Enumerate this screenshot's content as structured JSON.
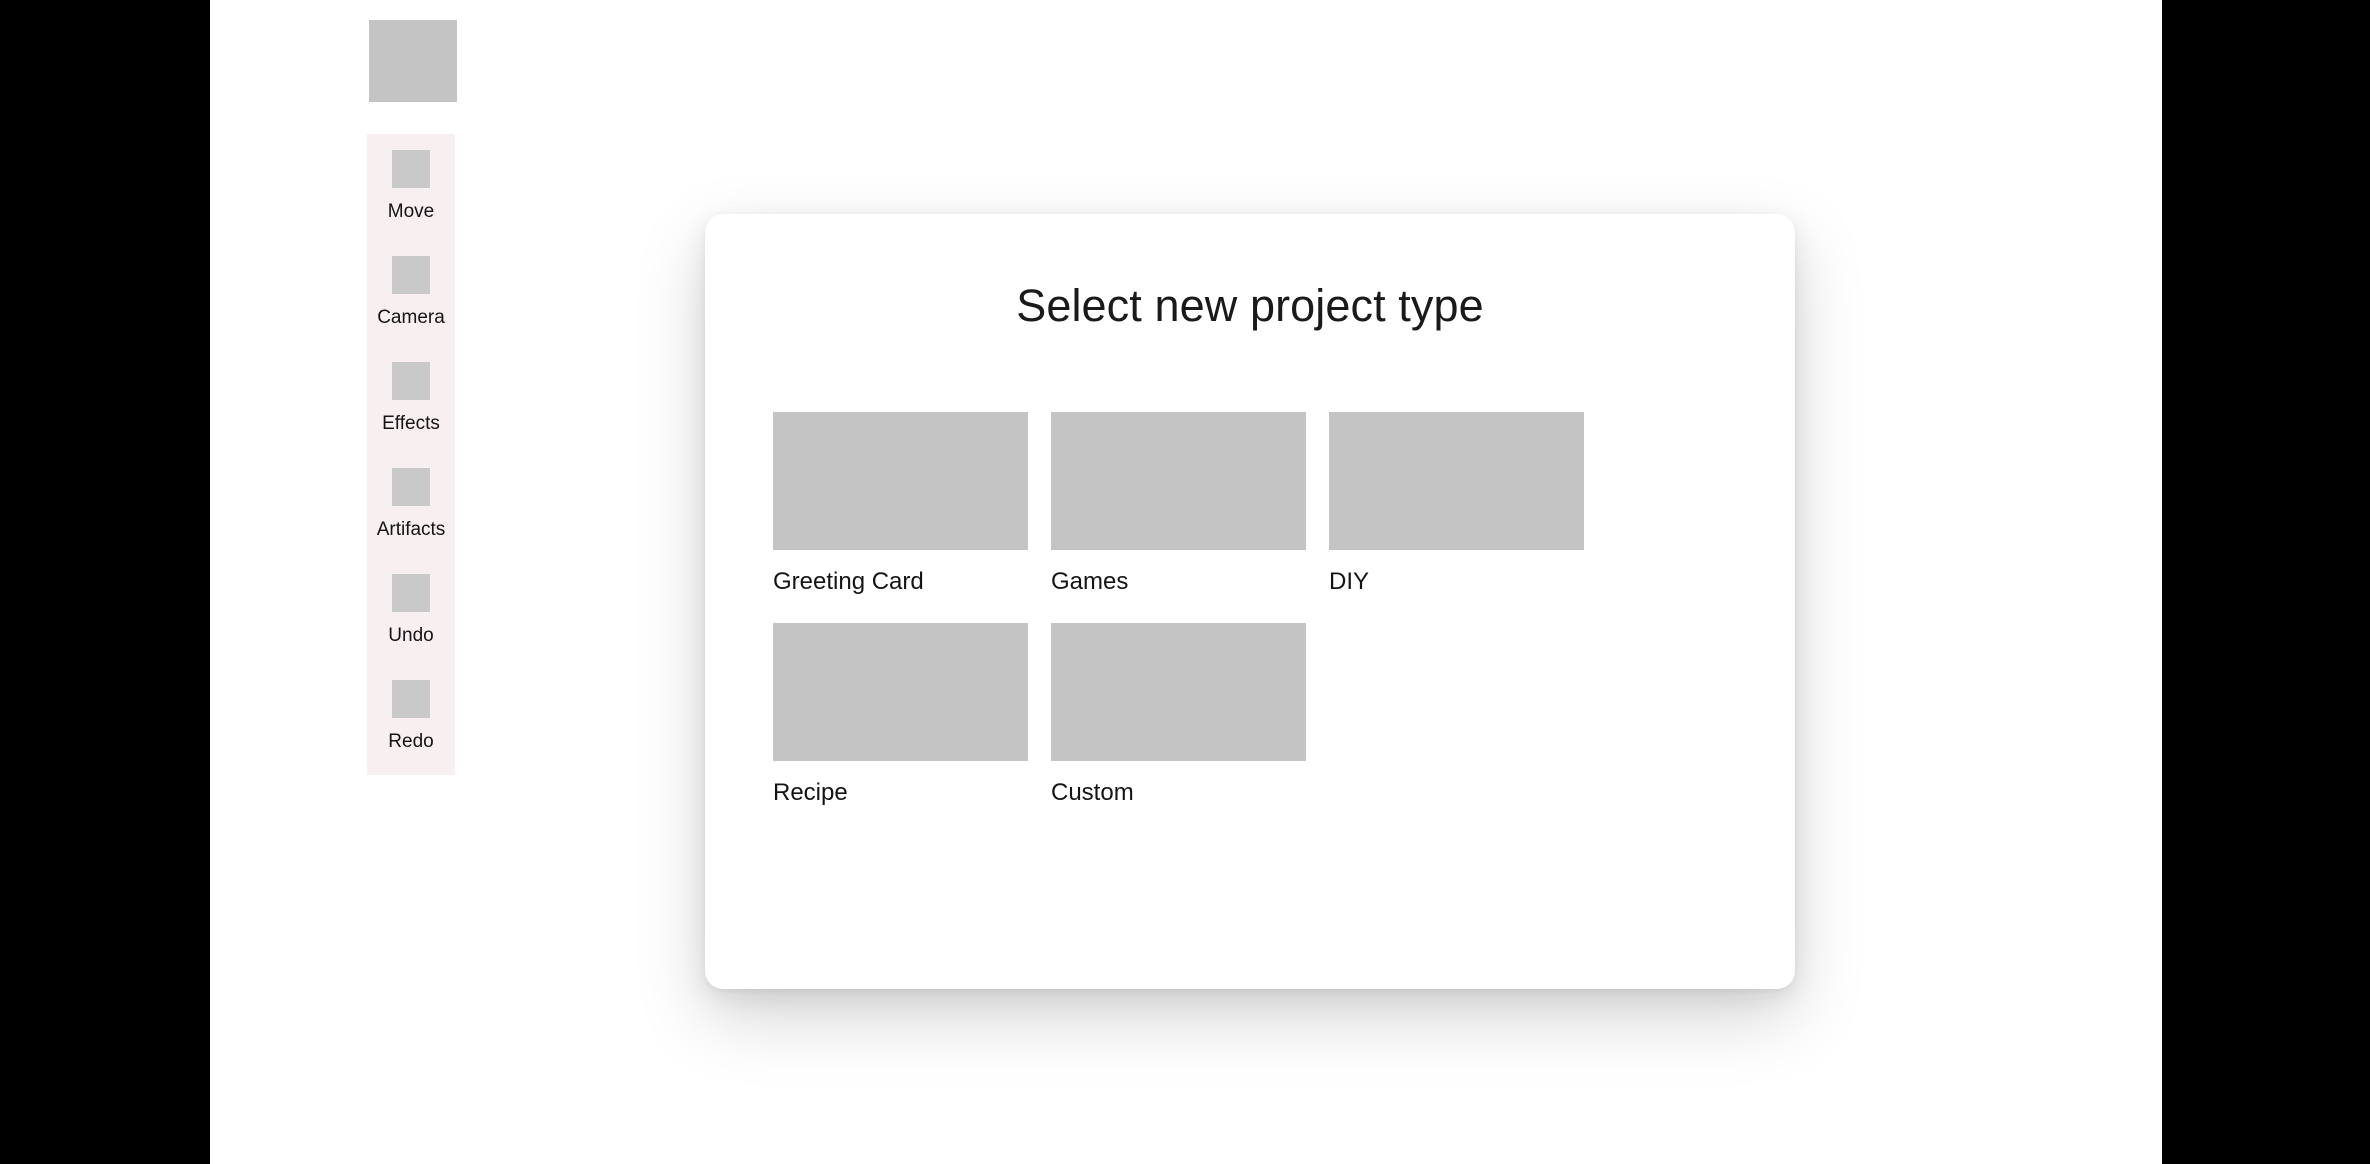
{
  "window": {
    "background_color": "#ffffff",
    "letterbox_color": "#000000"
  },
  "branding": {
    "logo_alt": "logo-placeholder"
  },
  "tool_rail": {
    "background_color": "#f7eff0",
    "items": [
      {
        "label": "Move",
        "icon": "move-icon"
      },
      {
        "label": "Camera",
        "icon": "camera-icon"
      },
      {
        "label": "Effects",
        "icon": "effects-icon"
      },
      {
        "label": "Artifacts",
        "icon": "artifacts-icon"
      },
      {
        "label": "Undo",
        "icon": "undo-icon"
      },
      {
        "label": "Redo",
        "icon": "redo-icon"
      }
    ]
  },
  "modal": {
    "title": "Select new project type",
    "background_color": "#ffffff",
    "project_types": [
      {
        "label": "Greeting Card",
        "thumb": "greeting-card-thumbnail"
      },
      {
        "label": "Games",
        "thumb": "games-thumbnail"
      },
      {
        "label": "DIY",
        "thumb": "diy-thumbnail"
      },
      {
        "label": "Recipe",
        "thumb": "recipe-thumbnail"
      },
      {
        "label": "Custom",
        "thumb": "custom-thumbnail"
      }
    ]
  }
}
